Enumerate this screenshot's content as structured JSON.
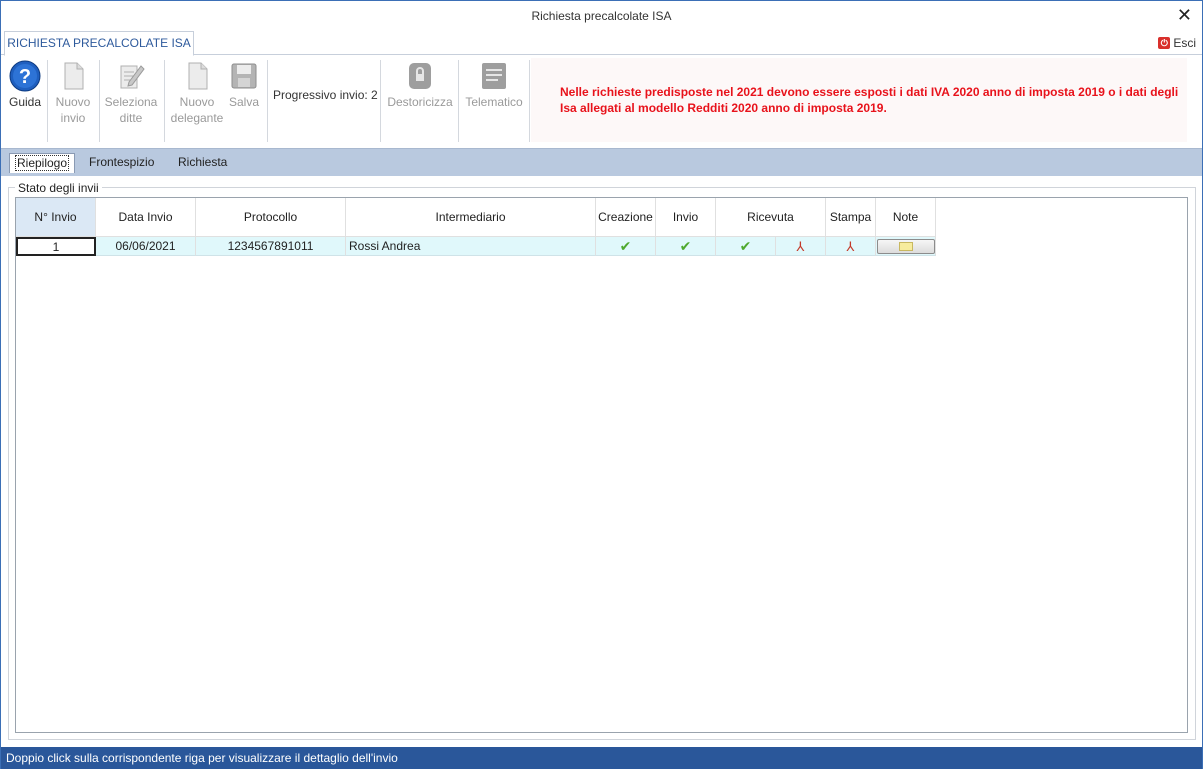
{
  "window": {
    "title": "Richiesta precalcolate ISA",
    "close_symbol": "✕"
  },
  "ribbon": {
    "tab_label": "RICHIESTA PRECALCOLATE ISA",
    "exit_label": "Esci"
  },
  "toolbar": {
    "guida": "Guida",
    "nuovo_invio": [
      "Nuovo",
      "invio"
    ],
    "seleziona_ditte": [
      "Seleziona",
      "ditte"
    ],
    "nuovo_delegante": [
      "Nuovo",
      "delegante"
    ],
    "salva": "Salva",
    "progressivo": "Progressivo invio: 2",
    "destoricizza": "Destoricizza",
    "telematico": "Telematico"
  },
  "warning": "Nelle richieste predisposte nel 2021 devono essere esposti i dati IVA 2020 anno di imposta 2019 o i dati degli Isa allegati al modello Redditi 2020 anno di imposta 2019.",
  "subtabs": [
    "Riepilogo",
    "Frontespizio",
    "Richiesta"
  ],
  "group_label": "Stato degli invii",
  "grid": {
    "headers": [
      "N° Invio",
      "Data Invio",
      "Protocollo",
      "Intermediario",
      "Creazione",
      "Invio",
      "Ricevuta",
      "Stampa",
      "Note"
    ],
    "rows": [
      {
        "n_invio": "1",
        "data_invio": "06/06/2021",
        "protocollo": "1234567891011",
        "intermediario": "Rossi Andrea"
      }
    ]
  },
  "icons": {
    "guida": "help-icon",
    "nuovo_invio": "new-document-icon",
    "seleziona_ditte": "edit-list-icon",
    "nuovo_delegante": "new-document-icon",
    "salva": "save-disk-icon",
    "destoricizza": "lock-icon",
    "telematico": "telematic-icon",
    "check": "check-icon",
    "pdf": "pdf-icon",
    "note": "note-icon"
  },
  "colors": {
    "accent": "#2a579a",
    "warning": "#e8121b",
    "subtab_bar": "#b9c9df",
    "row_bg": "#e0f8fb",
    "check": "#4fa92f"
  },
  "status": "Doppio click sulla corrispondente riga per visualizzare il dettaglio dell'invio"
}
